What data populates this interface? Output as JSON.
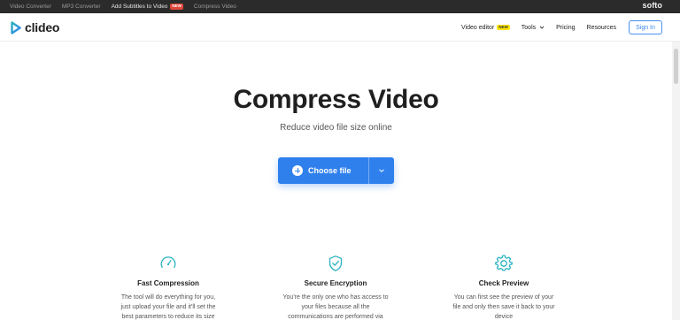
{
  "topbar": {
    "links": [
      {
        "label": "Video Converter",
        "active": false
      },
      {
        "label": "MP3 Converter",
        "active": false
      },
      {
        "label": "Add Subtitles to Video",
        "active": true,
        "badge": "NEW"
      },
      {
        "label": "Compress Video",
        "active": false
      }
    ],
    "brand": "softo"
  },
  "header": {
    "logo_text": "clideo",
    "nav": {
      "video_editor": "Video editor",
      "video_editor_badge": "NEW",
      "tools": "Tools",
      "pricing": "Pricing",
      "resources": "Resources",
      "sign_in": "Sign In"
    }
  },
  "hero": {
    "title": "Compress Video",
    "subtitle": "Reduce video file size online",
    "choose_file": "Choose file"
  },
  "features": [
    {
      "icon": "speedometer-icon",
      "title": "Fast Compression",
      "desc_1": "The tool will do everything for you,",
      "desc_2": "just upload your file and it'll set the",
      "desc_3": "best parameters to reduce its size"
    },
    {
      "icon": "shield-check-icon",
      "title": "Secure Encryption",
      "desc_1": "You're the only one who has access to",
      "desc_2": "your files because all the",
      "desc_3": "communications are performed via"
    },
    {
      "icon": "gear-icon",
      "title": "Check Preview",
      "desc_1": "You can first see the preview of your",
      "desc_2": "file and only then save it back to your",
      "desc_3": "device"
    }
  ],
  "colors": {
    "accent": "#2f80ed",
    "icon_teal": "#2bb3c0",
    "topbar_bg": "#2b2b2b",
    "new_badge_red": "#e0463a",
    "new_badge_yellow": "#ffe600"
  }
}
